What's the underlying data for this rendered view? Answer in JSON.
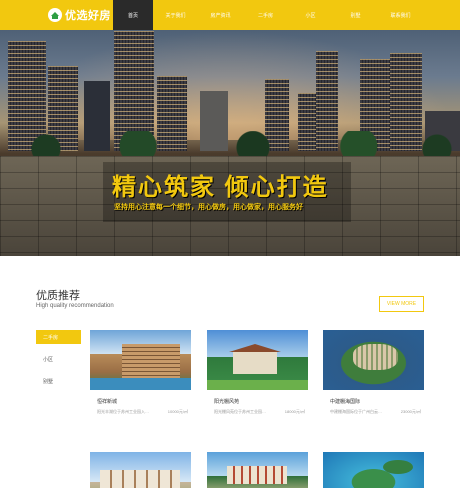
{
  "header": {
    "logo_text": "优选好房",
    "nav": [
      "首页",
      "关于我们",
      "房产资讯",
      "二手房",
      "小区",
      "别墅",
      "联系我们"
    ],
    "active_nav": "首页"
  },
  "hero": {
    "slogan": "精心筑家 倾心打造",
    "subline": "坚持用心注意每一个细节，用心做房，用心做家，用心服务好"
  },
  "section": {
    "title": "优质推荐",
    "subtitle": "High quality recommendation",
    "view_more": "VIEW MORE"
  },
  "filters": [
    "二手房",
    "小区",
    "别墅"
  ],
  "active_filter": "二手房",
  "cards": [
    {
      "name": "恒祥新城",
      "addr": "阳光丰湖位于苏州工业园入…",
      "price": "10000元/㎡"
    },
    {
      "name": "阳光棚风苑",
      "addr": "阳光棚风苑位于苏州工业园…",
      "price": "18000元/㎡"
    },
    {
      "name": "中建棚海国际",
      "addr": "中建棚海国际位于广州白云…",
      "price": "23000元/㎡"
    }
  ]
}
